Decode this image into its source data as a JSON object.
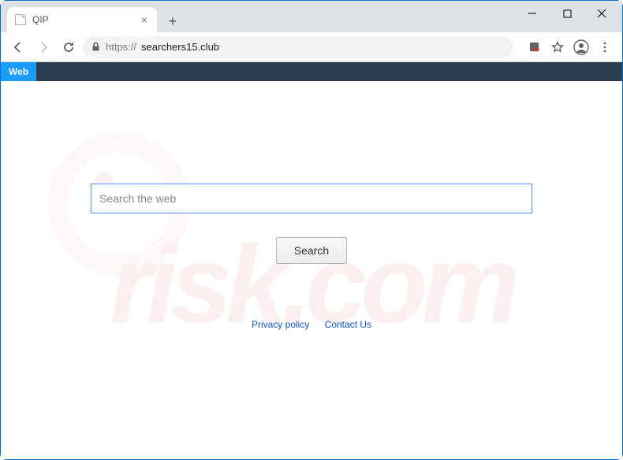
{
  "browser": {
    "tab_title": "QIP",
    "url_protocol": "https://",
    "url_host": "searchers15.club"
  },
  "nav": {
    "web_label": "Web"
  },
  "search": {
    "placeholder": "Search the web",
    "value": "",
    "button_label": "Search"
  },
  "footer": {
    "privacy": "Privacy policy",
    "contact": "Contact Us"
  },
  "watermark": {
    "text": "risk.com"
  }
}
